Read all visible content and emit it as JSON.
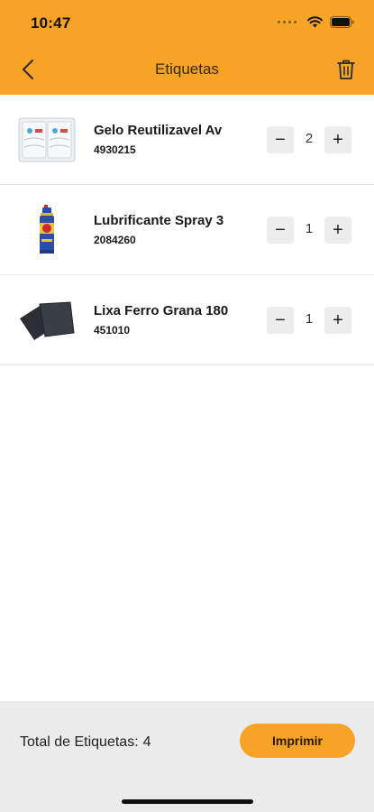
{
  "status_bar": {
    "time": "10:47"
  },
  "nav": {
    "title": "Etiquetas"
  },
  "items": [
    {
      "name": "Gelo Reutilizavel Av",
      "code": "4930215",
      "quantity": "2",
      "thumb_icon": "ice-pack-thumbnail"
    },
    {
      "name": "Lubrificante Spray 3",
      "code": "2084260",
      "quantity": "1",
      "thumb_icon": "spray-can-thumbnail"
    },
    {
      "name": "Lixa Ferro Grana 180",
      "code": "451010",
      "quantity": "1",
      "thumb_icon": "sandpaper-thumbnail"
    }
  ],
  "stepper": {
    "minus": "−",
    "plus": "+"
  },
  "footer": {
    "total_label": "Total de Etiquetas:",
    "total_value": "4",
    "print_label": "Imprimir"
  },
  "colors": {
    "accent": "#F7A325",
    "footer_bg": "#EBEBEB",
    "stepper_bg": "#EDEDED"
  }
}
